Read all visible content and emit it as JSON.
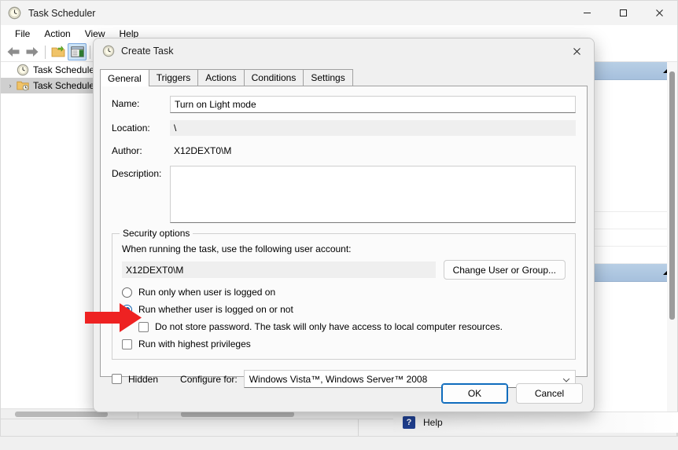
{
  "app": {
    "title": "Task Scheduler",
    "icon": "clock-icon",
    "window_controls": {
      "minimize": "—",
      "maximize": "☐",
      "close": "✕"
    },
    "menus": [
      "File",
      "Action",
      "View",
      "Help"
    ],
    "toolbar": [
      {
        "name": "back-arrow-icon",
        "label": "Back"
      },
      {
        "name": "forward-arrow-icon",
        "label": "Forward"
      },
      {
        "name": "new-folder-icon",
        "label": "New Folder"
      },
      {
        "name": "show-hide-pane-icon",
        "label": "Show/Hide Action Pane",
        "active": true
      }
    ],
    "tree": [
      {
        "label": "Task Scheduler (L",
        "icon": "clock-icon",
        "expander": "",
        "selected": false
      },
      {
        "label": "Task Schedule",
        "icon": "task-folder-icon",
        "expander": "›",
        "selected": true
      }
    ],
    "status_bar": {
      "cells": 3
    }
  },
  "actions_pane": {
    "headers": [
      "actions-header-top",
      "actions-header-bottom"
    ],
    "collapse_icon": "collapse-triangle-icon",
    "submenu_icon": "submenu-arrow-icon"
  },
  "help": {
    "icon": "help-question-icon",
    "glyph": "?",
    "label": "Help"
  },
  "dialog": {
    "title": "Create Task",
    "icon": "clock-icon",
    "close_glyph": "✕",
    "tabs": [
      {
        "label": "General",
        "active": true
      },
      {
        "label": "Triggers",
        "active": false
      },
      {
        "label": "Actions",
        "active": false
      },
      {
        "label": "Conditions",
        "active": false
      },
      {
        "label": "Settings",
        "active": false
      }
    ],
    "general": {
      "name_label": "Name:",
      "name_value": "Turn on Light mode",
      "name_placeholder": "",
      "location_label": "Location:",
      "location_value": "\\",
      "author_label": "Author:",
      "author_value": "X12DEXT0\\M",
      "description_label": "Description:",
      "description_value": "",
      "description_placeholder": "",
      "security": {
        "group_title": "Security options",
        "account_prompt": "When running the task, use the following user account:",
        "account_value": "X12DEXT0\\M",
        "change_user_button": "Change User or Group...",
        "radio_logged_on": {
          "label": "Run only when user is logged on",
          "checked": false
        },
        "radio_logged_on_or_not": {
          "label": "Run whether user is logged on or not",
          "checked": true
        },
        "check_no_store_password": {
          "label": "Do not store password.  The task will only have access to local computer resources.",
          "checked": false
        },
        "check_highest_privileges": {
          "label": "Run with highest privileges",
          "checked": false
        }
      },
      "hidden_label": "Hidden",
      "hidden_checked": false,
      "configure_for_label": "Configure for:",
      "configure_for_value": "Windows Vista™, Windows Server™ 2008"
    },
    "footer": {
      "ok_label": "OK",
      "cancel_label": "Cancel"
    }
  },
  "annotation": {
    "arrow": "red-pointer-arrow",
    "color": "#ee2222",
    "points_at": "do-not-store-password-checkbox"
  },
  "colors": {
    "accent": "#0f5fb0",
    "focus_border": "#0f6cbd",
    "pane_header_top": "#b8cfe5",
    "pane_header_bottom": "#a6c0dd",
    "selection": "#cfcfcf",
    "annotation_red": "#ee2222"
  }
}
